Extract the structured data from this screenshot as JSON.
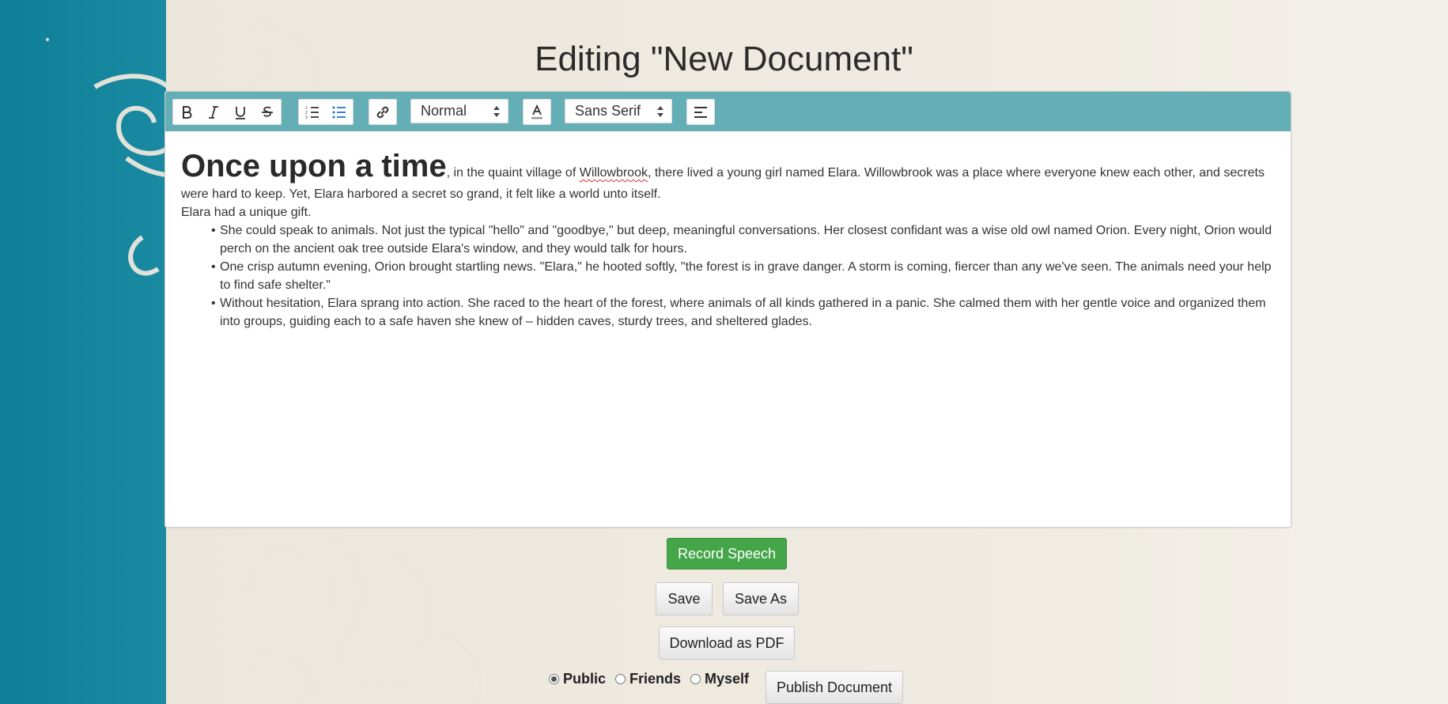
{
  "page": {
    "title": "Editing \"New Document\""
  },
  "toolbar": {
    "heading_select": "Normal",
    "font_select": "Sans Serif"
  },
  "document": {
    "heading": "Once upon a time",
    "intro_pre": ", in the quaint village of ",
    "intro_place": "Willowbrook",
    "intro_post": ", there lived a young girl named Elara. Willowbrook was a place where everyone knew each other, and secrets were hard to keep. Yet, Elara harbored a secret so grand, it felt like a world unto itself.",
    "line2": "Elara had a unique gift.",
    "bullets": [
      "She could speak to animals. Not just the typical \"hello\" and \"goodbye,\" but deep, meaningful conversations. Her closest confidant was a wise old owl named Orion. Every night, Orion would perch on the ancient oak tree outside Elara's window, and they would talk for hours.",
      "One crisp autumn evening, Orion brought startling news. \"Elara,\" he hooted softly, \"the forest is in grave danger. A storm is coming, fiercer than any we've seen. The animals need your help to find safe shelter.\"",
      "Without hesitation, Elara sprang into action. She raced to the heart of the forest, where animals of all kinds gathered in a panic. She calmed them with her gentle voice and organized them into groups, guiding each to a safe haven she knew of – hidden caves, sturdy trees, and sheltered glades."
    ]
  },
  "actions": {
    "record_speech": "Record Speech",
    "save": "Save",
    "save_as": "Save As",
    "download_pdf": "Download as PDF",
    "publish": "Publish Document"
  },
  "visibility": {
    "options": [
      "Public",
      "Friends",
      "Myself"
    ],
    "selected": "Public"
  },
  "colors": {
    "toolbar": "#64aeb6",
    "record_button": "#45a549",
    "background_teal": "#0f7f97"
  }
}
